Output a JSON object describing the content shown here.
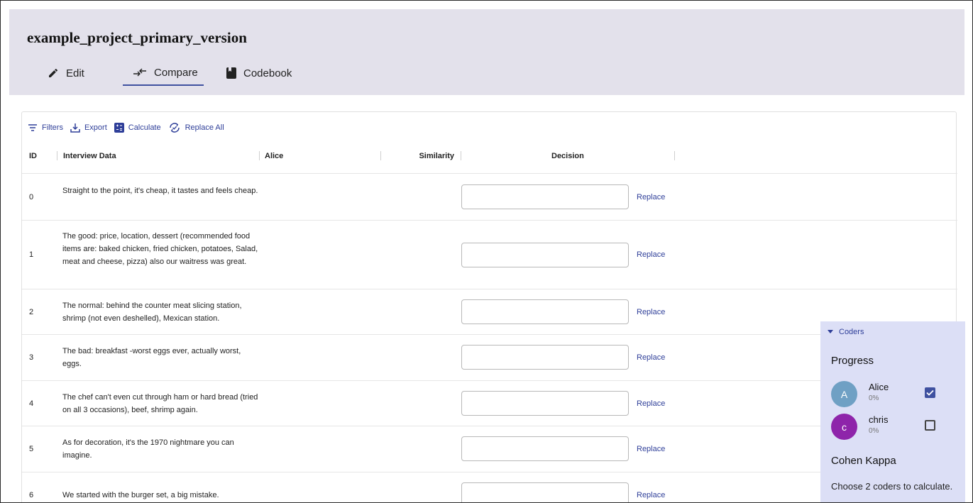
{
  "project": {
    "title": "example_project_primary_version"
  },
  "tabs": [
    {
      "label": "Edit",
      "icon": "pencil-icon"
    },
    {
      "label": "Compare",
      "icon": "compare-arrows-icon",
      "active": true
    },
    {
      "label": "Codebook",
      "icon": "book-icon"
    }
  ],
  "toolbar": {
    "filters": "Filters",
    "export": "Export",
    "calculate": "Calculate",
    "replace_all": "Replace All"
  },
  "table": {
    "columns": [
      "ID",
      "Interview Data",
      "Alice",
      "Similarity",
      "Decision"
    ],
    "replace_label": "Replace",
    "rows": [
      {
        "id": "0",
        "text": "Straight to the point, it's cheap, it tastes and feels cheap.",
        "decision": ""
      },
      {
        "id": "1",
        "text": "The good: price, location, dessert (recommended food items are: baked chicken, fried chicken, potatoes, Salad, meat and cheese, pizza) also our waitress was great.",
        "decision": ""
      },
      {
        "id": "2",
        "text": "The normal: behind the counter meat slicing station, shrimp (not even deshelled), Mexican station.",
        "decision": ""
      },
      {
        "id": "3",
        "text": "The bad: breakfast -worst eggs ever, actually worst, eggs.",
        "decision": ""
      },
      {
        "id": "4",
        "text": "The chef can't even cut through ham or hard bread (tried on all 3 occasions), beef, shrimp again.",
        "decision": ""
      },
      {
        "id": "5",
        "text": "As for decoration, it's the 1970 nightmare you can imagine.",
        "decision": ""
      },
      {
        "id": "6",
        "text": "We started with the burger set, a big mistake.",
        "decision": ""
      }
    ]
  },
  "coders_panel": {
    "toggle_label": "Coders",
    "progress_title": "Progress",
    "coders": [
      {
        "initial": "A",
        "name": "Alice",
        "progress": "0%",
        "checked": true,
        "color": "#6fa0c4"
      },
      {
        "initial": "c",
        "name": "chris",
        "progress": "0%",
        "checked": false,
        "color": "#8e24aa"
      }
    ],
    "kappa_title": "Cohen Kappa",
    "kappa_message": "Choose 2 coders to calculate."
  },
  "colors": {
    "accent": "#3f51a0",
    "header_bg": "#e3e1eb",
    "panel_bg": "#dcdff6"
  }
}
